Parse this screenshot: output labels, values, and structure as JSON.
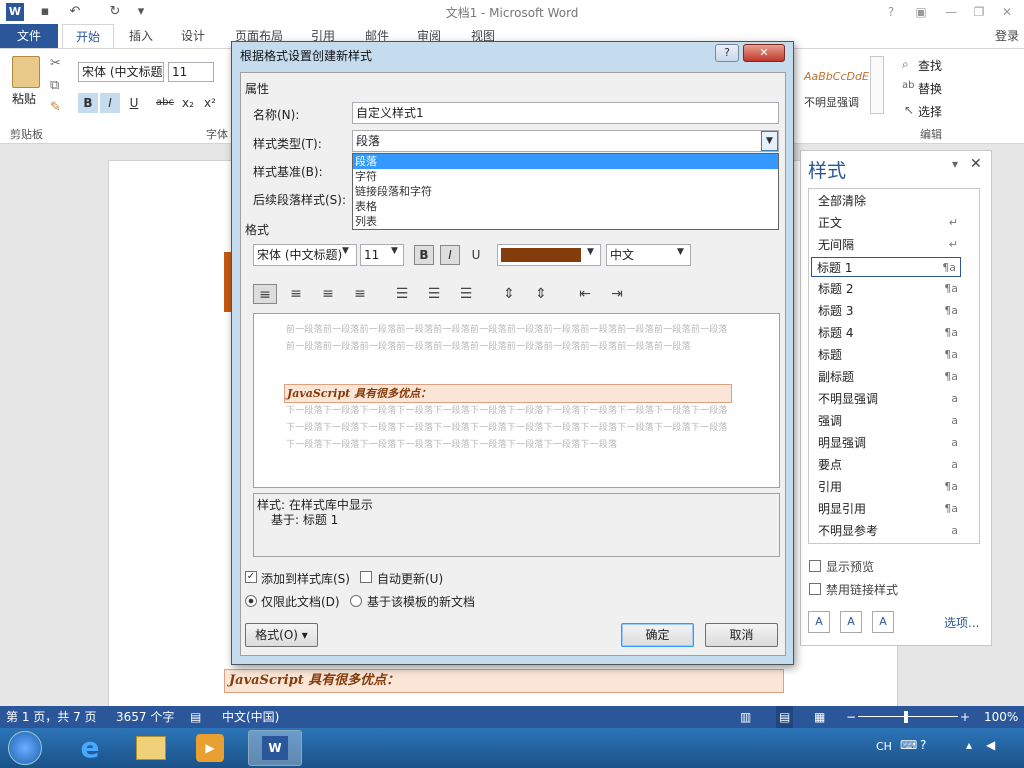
{
  "app": {
    "title": "文档1 - Microsoft Word",
    "signin": "登录"
  },
  "tabs": [
    "文件",
    "开始",
    "插入",
    "设计",
    "页面布局",
    "引用",
    "邮件",
    "审阅",
    "视图"
  ],
  "ribbon": {
    "paste": "粘贴",
    "clipboard_group": "剪贴板",
    "font_group": "字体",
    "font_name": "宋体 (中文标题",
    "font_size": "11",
    "bold": "B",
    "italic": "I",
    "underline": "U",
    "strike": "abc",
    "sub": "x₂",
    "sup": "x²",
    "style_preview": "AaBbCcDdE",
    "style_preview_name": "不明显强调",
    "find": "查找",
    "replace": "替换",
    "select": "选择",
    "edit_group": "编辑"
  },
  "dialog": {
    "title": "根据格式设置创建新样式",
    "help": "?",
    "close": "✕",
    "properties_section": "属性",
    "name_label": "名称(N):",
    "name_value": "自定义样式1",
    "type_label": "样式类型(T):",
    "type_value": "段落",
    "based_label": "样式基准(B):",
    "next_label": "后续段落样式(S):",
    "type_options": [
      "段落",
      "字符",
      "链接段落和字符",
      "表格",
      "列表"
    ],
    "format_section": "格式",
    "font_name": "宋体 (中文标题)",
    "font_size": "11",
    "bold": "B",
    "italic": "I",
    "underline": "U",
    "color_hex": "#843c0c",
    "script": "中文",
    "preview_prev": "前一段落前一段落前一段落前一段落前一段落前一段落前一段落前一段落前一段落前一段落前一段落前一段落前一段落前一段落前一段落前一段落前一段落前一段落前一段落前一段落前一段落前一段落前一段落",
    "preview_sample": "JavaScript 具有很多优点：",
    "preview_next": "下一段落下一段落下一段落下一段落下一段落下一段落下一段落下一段落下一段落下一段落下一段落下一段落下一段落下一段落下一段落下一段落下一段落下一段落下一段落下一段落下一段落下一段落下一段落下一段落下一段落下一段落下一段落下一段落下一段落下一段落下一段落下一段落下一段落",
    "desc_line1": "样式: 在样式库中显示",
    "desc_line2": "基于: 标题 1",
    "add_to_gallery": "添加到样式库(S)",
    "auto_update": "自动更新(U)",
    "only_this_doc": "仅限此文档(D)",
    "new_docs_template": "基于该模板的新文档",
    "format_button": "格式(O) ▾",
    "ok": "确定",
    "cancel": "取消"
  },
  "styles_pane": {
    "title": "样式",
    "items": [
      {
        "name": "全部清除",
        "mark": ""
      },
      {
        "name": "正文",
        "mark": "↵"
      },
      {
        "name": "无间隔",
        "mark": "↵"
      },
      {
        "name": "标题 1",
        "mark": "¶a"
      },
      {
        "name": "标题 2",
        "mark": "¶a"
      },
      {
        "name": "标题 3",
        "mark": "¶a"
      },
      {
        "name": "标题 4",
        "mark": "¶a"
      },
      {
        "name": "标题",
        "mark": "¶a"
      },
      {
        "name": "副标题",
        "mark": "¶a"
      },
      {
        "name": "不明显强调",
        "mark": "a"
      },
      {
        "name": "强调",
        "mark": "a"
      },
      {
        "name": "明显强调",
        "mark": "a"
      },
      {
        "name": "要点",
        "mark": "a"
      },
      {
        "name": "引用",
        "mark": "¶a"
      },
      {
        "name": "明显引用",
        "mark": "¶a"
      },
      {
        "name": "不明显参考",
        "mark": "a"
      }
    ],
    "show_preview": "显示预览",
    "disable_linked": "禁用链接样式",
    "options": "选项..."
  },
  "document": {
    "line": "JavaScript 具有很多优点："
  },
  "status": {
    "page": "第 1 页，共 7 页",
    "words": "3657 个字",
    "lang": "中文(中国)",
    "zoom": "100%"
  },
  "taskbar": {
    "ime": "CH"
  }
}
